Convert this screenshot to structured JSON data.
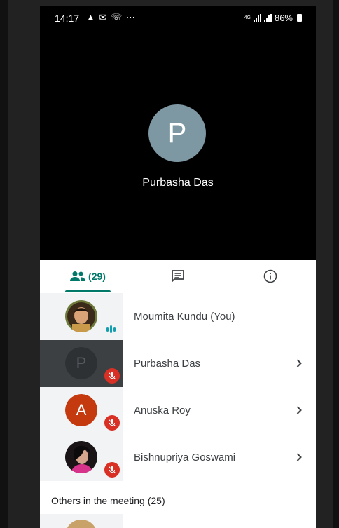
{
  "status_bar": {
    "time": "14:17",
    "notification_icons": [
      "upload-icon",
      "mail-icon",
      "whatsapp-icon",
      "more-dots-icon"
    ],
    "network": "4G",
    "battery": "86%"
  },
  "spotlight": {
    "initial": "P",
    "name": "Purbasha Das",
    "avatar_color": "#7d97a3"
  },
  "tabs": {
    "people_count": "(29)",
    "active": "people"
  },
  "participants": [
    {
      "name": "Moumita Kundu (You)",
      "state": "speaking",
      "avatar": "photo"
    },
    {
      "name": "Purbasha Das",
      "state": "muted",
      "avatar": "initial",
      "initial": "P"
    },
    {
      "name": "Anuska Roy",
      "state": "muted",
      "avatar": "initial",
      "initial": "A"
    },
    {
      "name": "Bishnupriya Goswami",
      "state": "muted",
      "avatar": "photo"
    }
  ],
  "others_heading": "Others in the meeting (25)",
  "colors": {
    "accent": "#00796b",
    "muted": "#d93025",
    "speaking": "#129eaf",
    "anuska_avatar": "#c5390f"
  }
}
